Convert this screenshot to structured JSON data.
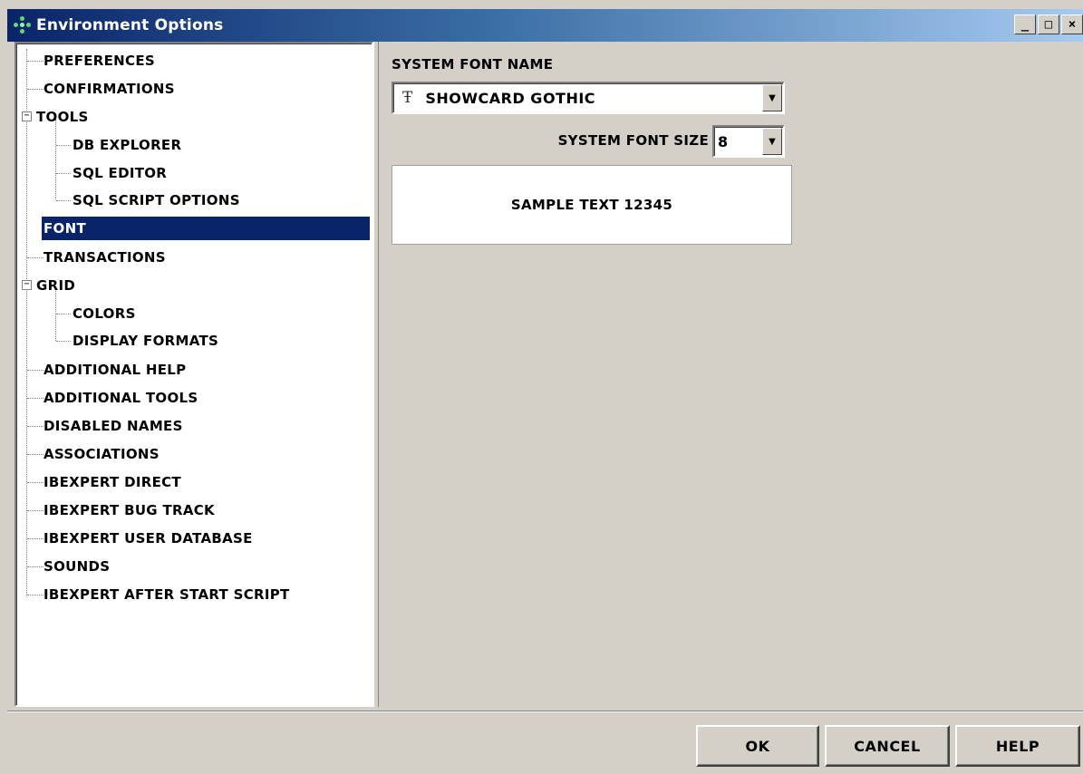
{
  "window": {
    "title": "Environment Options",
    "icon": "app-dots-icon",
    "controls": {
      "minimize": "_",
      "maximize": "□",
      "close": "×"
    }
  },
  "tree": {
    "items": [
      {
        "label": "PREFERENCES"
      },
      {
        "label": "CONFIRMATIONS"
      },
      {
        "label": "TOOLS",
        "expanded": true
      },
      {
        "label": "DB EXPLORER"
      },
      {
        "label": "SQL EDITOR"
      },
      {
        "label": "SQL SCRIPT OPTIONS"
      },
      {
        "label": "FONT",
        "selected": true
      },
      {
        "label": "TRANSACTIONS"
      },
      {
        "label": "GRID",
        "expanded": true
      },
      {
        "label": "COLORS"
      },
      {
        "label": "DISPLAY FORMATS"
      },
      {
        "label": "ADDITIONAL HELP"
      },
      {
        "label": "ADDITIONAL TOOLS"
      },
      {
        "label": "DISABLED NAMES"
      },
      {
        "label": "ASSOCIATIONS"
      },
      {
        "label": "IBEXPERT DIRECT"
      },
      {
        "label": "IBEXPERT BUG TRACK"
      },
      {
        "label": "IBEXPERT USER DATABASE"
      },
      {
        "label": "SOUNDS"
      },
      {
        "label": "IBEXPERT AFTER START SCRIPT"
      }
    ],
    "expander_symbol": "−"
  },
  "font_panel": {
    "font_name_label": "SYSTEM FONT NAME",
    "font_name_value": "SHOWCARD GOTHIC",
    "font_type_icon": "Ŧ",
    "font_size_label": "SYSTEM FONT SIZE",
    "font_size_value": "8",
    "dropdown_arrow": "▼",
    "sample_text": "SAMPLE TEXT 12345"
  },
  "buttons": {
    "ok": "OK",
    "cancel": "CANCEL",
    "help": "HELP"
  },
  "colors": {
    "selection": "#0a246a",
    "face": "#d4d0c8"
  }
}
